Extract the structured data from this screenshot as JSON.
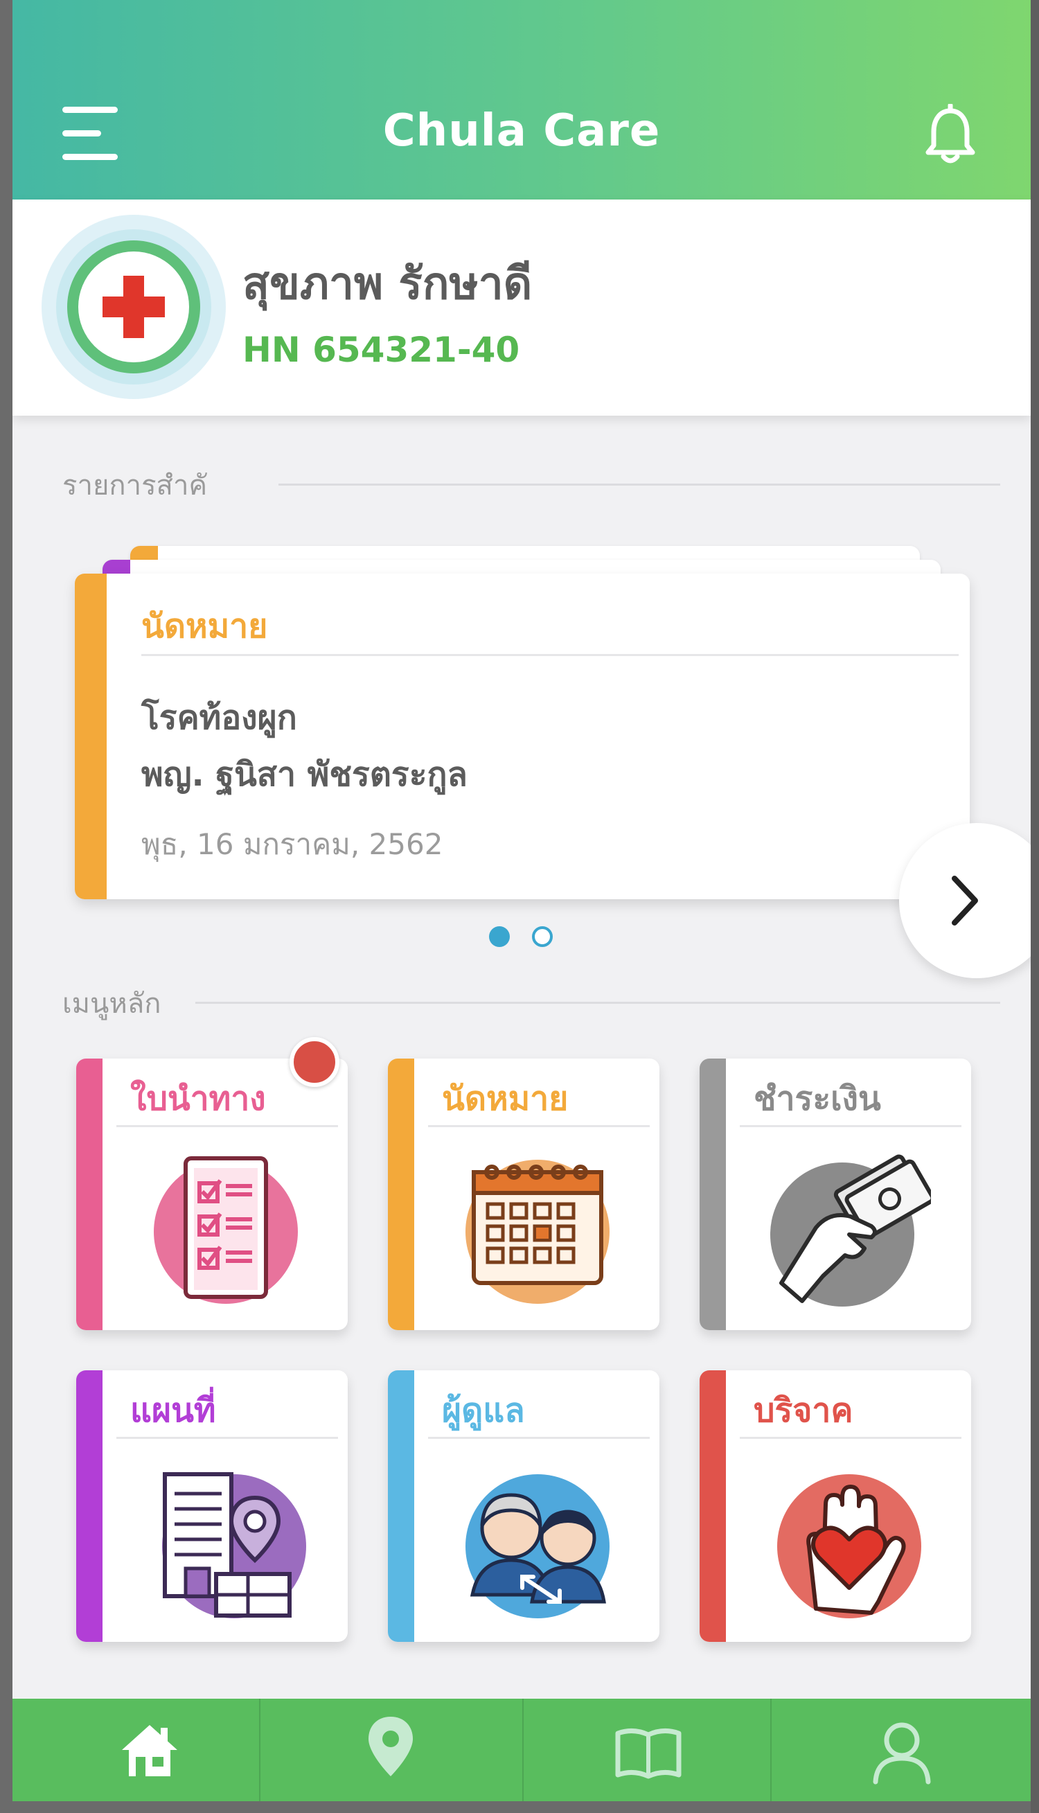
{
  "header": {
    "title": "Chula Care",
    "menu_icon": "hamburger-menu-icon",
    "notification_icon": "bell-icon"
  },
  "profile": {
    "name": "สุขภาพ รักษาดี",
    "hn": "HN 654321-40",
    "avatar_icon": "red-cross-icon"
  },
  "important": {
    "section_title": "รายการสำคั",
    "card": {
      "type_label": "นัดหมาย",
      "line1": "โรคท้องผูก",
      "line2": "พญ. ฐนิสา พัชรตระกูล",
      "date": "พุธ, 16 มกราคม, 2562"
    },
    "pager": {
      "current": 1,
      "total": 2
    },
    "next_icon": "chevron-right-icon"
  },
  "main_menu": {
    "section_title": "เมนูหลัก",
    "tiles": [
      {
        "label": "ใบนำทาง",
        "color": "#e85f92",
        "icon": "checklist-icon",
        "has_badge": true
      },
      {
        "label": "นัดหมาย",
        "color": "#f3a93a",
        "icon": "calendar-icon",
        "has_badge": false
      },
      {
        "label": "ชำระเงิน",
        "color": "#9a9a9a",
        "icon": "payment-cash-icon",
        "has_badge": false
      },
      {
        "label": "แผนที่",
        "color": "#b23ed6",
        "icon": "hospital-map-icon",
        "has_badge": false
      },
      {
        "label": "ผู้ดูแล",
        "color": "#5bb8e3",
        "icon": "caregiver-icon",
        "has_badge": false
      },
      {
        "label": "บริจาค",
        "color": "#e0534b",
        "icon": "donation-heart-icon",
        "has_badge": false
      }
    ]
  },
  "bottom_nav": {
    "items": [
      {
        "name": "home-icon",
        "active": true
      },
      {
        "name": "location-pin-icon",
        "active": false
      },
      {
        "name": "book-icon",
        "active": false
      },
      {
        "name": "user-profile-icon",
        "active": false
      }
    ]
  },
  "colors": {
    "header_gradient_start": "#45b8a4",
    "header_gradient_end": "#7fd66f",
    "accent_green": "#56b851",
    "nav_green": "#59bd5e",
    "pager_blue": "#3aa6cf",
    "badge_red": "#d84f45"
  }
}
